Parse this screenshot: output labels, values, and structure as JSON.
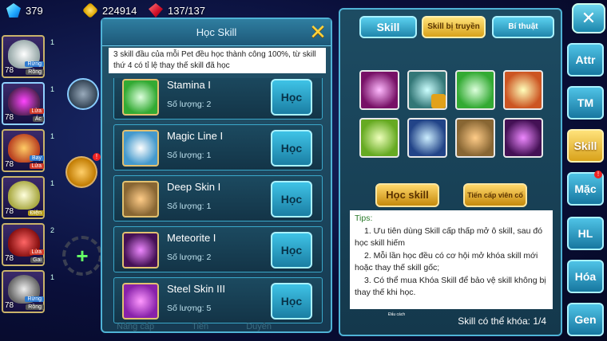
{
  "resources": {
    "gems": "379",
    "gold": "224914",
    "energy": "137/137"
  },
  "pets": [
    {
      "level": "78",
      "tag1": "Rừng",
      "tag2": "Rồng",
      "side": "1"
    },
    {
      "level": "78",
      "tag1": "Lửa",
      "tag2": "Ác",
      "side": "1"
    },
    {
      "level": "78",
      "tag1": "Bay",
      "tag2": "Lửa",
      "side": "1"
    },
    {
      "level": "78",
      "tag1": "Điện",
      "tag2": "",
      "side": "1"
    },
    {
      "level": "78",
      "tag1": "Lửa",
      "tag2": "Gai",
      "side": "2"
    },
    {
      "level": "78",
      "tag1": "Rừng",
      "tag2": "Rồng",
      "side": "1"
    }
  ],
  "learn_panel": {
    "title": "Học Skill",
    "description": "3 skill đầu của mỗi Pet đều học thành công 100%, từ skill thứ 4 có tỉ lệ thay thế skill đã học",
    "skills": [
      {
        "name": "Stamina I",
        "qty_label": "Số lượng:",
        "qty": "2",
        "button": "Học"
      },
      {
        "name": "Magic Line I",
        "qty_label": "Số lượng:",
        "qty": "1",
        "button": "Học"
      },
      {
        "name": "Deep Skin I",
        "qty_label": "Số lượng:",
        "qty": "1",
        "button": "Học"
      },
      {
        "name": "Meteorite I",
        "qty_label": "Số lượng:",
        "qty": "2",
        "button": "Học"
      },
      {
        "name": "Steel Skin III",
        "qty_label": "Số lượng:",
        "qty": "5",
        "button": "Học"
      }
    ],
    "bottom_labels": [
      "Nâng cấp",
      "Tiến",
      "Duyên"
    ]
  },
  "skill_panel": {
    "tabs": [
      "Skill",
      "Skill bị truyền",
      "Bí thuật"
    ],
    "learn_button": "Học skill",
    "upgrade_button": "Tiến cấp viên cố",
    "tips_title": "Tips:",
    "tips": [
      "1. Ưu tiên dùng Skill cấp thấp mở ô skill, sau đó học skill hiếm",
      "2. Mỗi lần học đều có cơ hội mở khóa skill mới hoặc thay thế skill gốc;",
      "3. Có thể mua Khóa Skill để bảo vệ skill không bị thay thế khi học."
    ],
    "tiny_label": "Đấu cách",
    "lockable_label": "Skill có thể khóa:",
    "lockable_value": "1/4"
  },
  "side_buttons": [
    "Attr",
    "TM",
    "Skill",
    "Mặc",
    "HL",
    "Hóa",
    "Gen"
  ],
  "colors": {
    "accent_gold": "#d9a21a",
    "panel_blue": "#1d4c63",
    "button_blue": "#1f85ab"
  }
}
